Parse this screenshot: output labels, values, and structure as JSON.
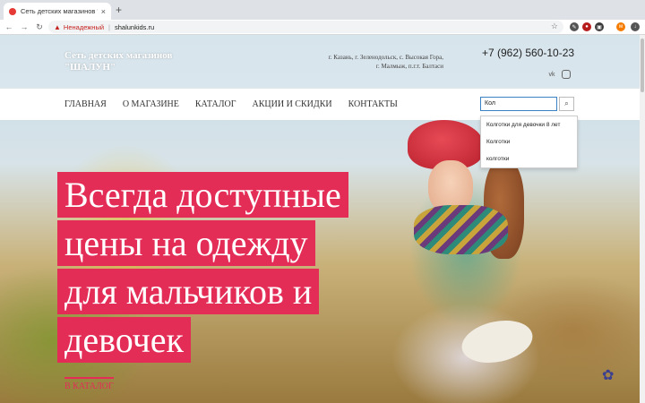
{
  "browser": {
    "tab_title": "Сеть детских магазинов \"ША",
    "tab_close": "×",
    "new_tab": "+",
    "security_label": "Ненадежный",
    "url": "shalunkids.ru"
  },
  "header": {
    "brand_line1": "Сеть детских магазинов",
    "brand_line2": "\"ШАЛУН\"",
    "cities": "г. Казань, г. Зеленодольск, с. Высокая Гора, г. Малмыж, п.г.т. Балтаси",
    "phone": "+7 (962) 560-10-23",
    "social": [
      "vk",
      "instagram"
    ]
  },
  "nav": {
    "items": [
      "ГЛАВНАЯ",
      "О МАГАЗИНЕ",
      "КАТАЛОГ",
      "АКЦИИ И СКИДКИ",
      "КОНТАКТЫ"
    ]
  },
  "search": {
    "value": "Кол"
  },
  "suggestions": [
    "Колготки для девочки 8 лет",
    "Колготки",
    "колготки"
  ],
  "hero": {
    "line1": "Всегда доступные",
    "line2": "цены на одежду",
    "line3": "для мальчиков и",
    "line4": "девочек",
    "catalog_link": "В КАТАЛОГ"
  },
  "colors": {
    "accent": "#e32d57",
    "search_border": "#3b82c4"
  }
}
